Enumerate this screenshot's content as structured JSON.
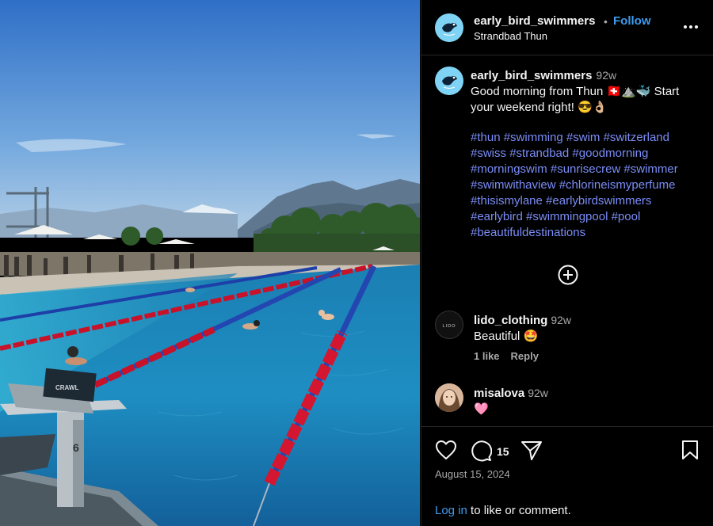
{
  "post": {
    "username": "early_bird_swimmers",
    "separator": "•",
    "follow_label": "Follow",
    "location": "Strandbad Thun",
    "caption": {
      "username": "early_bird_swimmers",
      "time": "92w",
      "text_line1": "Good morning from Thun 🇨🇭⛰️🐳 Start",
      "text_line2": "your weekend right! 😎👌🏼",
      "hashtags": [
        "#thun",
        "#swimming",
        "#swim",
        "#switzerland",
        "#swiss",
        "#strandbad",
        "#goodmorning",
        "#morningswim",
        "#sunrisecrew",
        "#swimmer",
        "#swimwithaview",
        "#chlorineismyperfume",
        "#thisismylane",
        "#earlybirdswimmers",
        "#earlybird",
        "#swimmingpool",
        "#pool",
        "#beautifuldestinations"
      ]
    },
    "photo": {
      "signage_text": "CRAWL",
      "block_number": "6"
    }
  },
  "comments": [
    {
      "username": "lido_clothing",
      "time": "92w",
      "text": "Beautiful 🤩",
      "likes": "1 like",
      "reply": "Reply",
      "avatar_text": "LIDO"
    },
    {
      "username": "misalova",
      "time": "92w",
      "text": "🩷"
    }
  ],
  "actions": {
    "comment_count": "15",
    "date": "August 15, 2024",
    "login_link": "Log in",
    "login_rest": " to like or comment."
  },
  "icons": {
    "more": "more-options-icon",
    "like": "heart-icon",
    "comment": "comment-bubble-icon",
    "share": "send-icon",
    "save": "bookmark-icon",
    "load_more": "plus-circle-icon"
  },
  "colors": {
    "background": "#000000",
    "link": "#3d9cf0",
    "hashtag": "#7b8df7",
    "muted": "#a8a8a8",
    "avatar_bg": "#7fd3f4"
  }
}
